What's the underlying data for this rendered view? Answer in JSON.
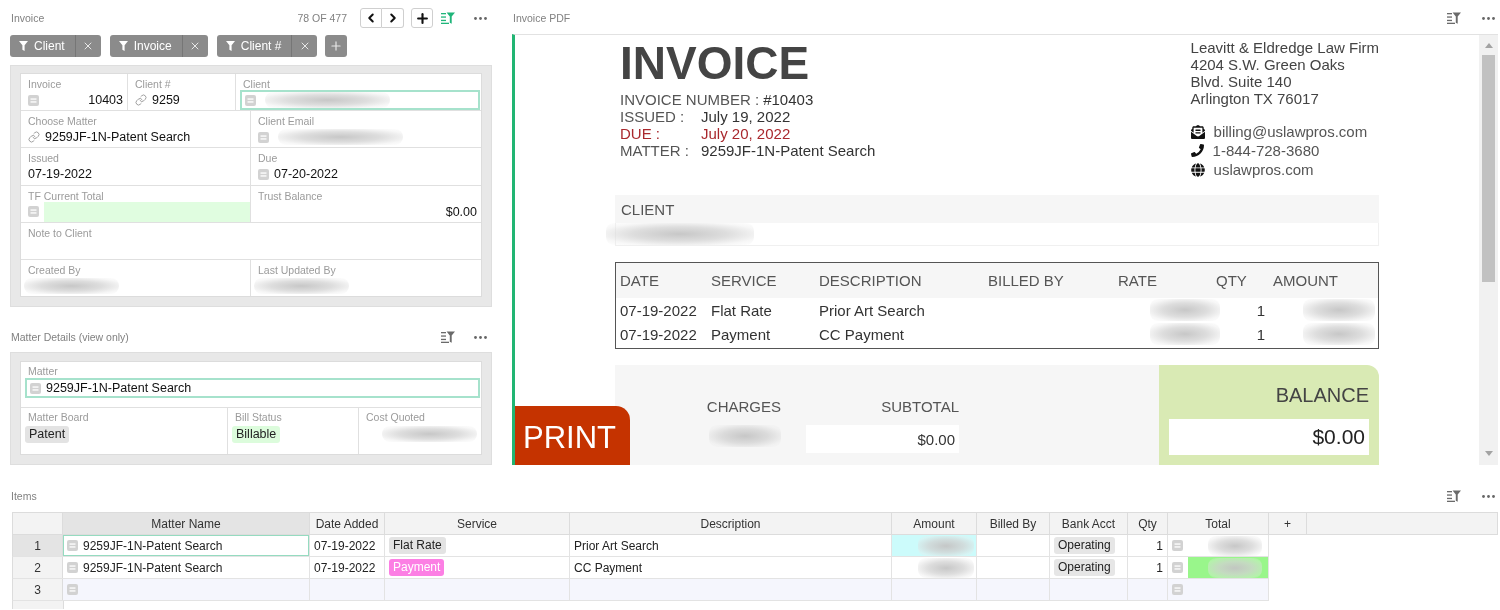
{
  "invoice_panel": {
    "title": "Invoice",
    "filtered": true,
    "position": "78 OF 477",
    "filters": [
      {
        "label": "Client"
      },
      {
        "label": "Invoice"
      },
      {
        "label": "Client #"
      }
    ],
    "rows": [
      [
        {
          "label": "Invoice",
          "kind": "number",
          "value": "10403",
          "focused": false,
          "highlighted": false,
          "redacted": false
        },
        {
          "label": "Client #",
          "kind": "link",
          "value": "9259",
          "focused": false,
          "highlighted": false,
          "redacted": false
        },
        {
          "label": "Client",
          "kind": "lookup",
          "focused": true,
          "highlighted": false,
          "redacted": true
        }
      ],
      [
        {
          "label": "Choose Matter",
          "kind": "link",
          "value": "9259JF-1N-Patent Search",
          "focused": false,
          "highlighted": false,
          "redacted": false
        },
        {
          "label": "Client Email",
          "kind": "lookup",
          "focused": false,
          "highlighted": false,
          "redacted": true
        }
      ],
      [
        {
          "label": "Issued",
          "kind": "text",
          "value": "07-19-2022",
          "focused": false,
          "highlighted": false,
          "redacted": false
        },
        {
          "label": "Due",
          "kind": "lookup",
          "value": "07-20-2022",
          "focused": false,
          "highlighted": false,
          "redacted": false
        }
      ],
      [
        {
          "label": "TF Current Total",
          "kind": "lookup",
          "focused": false,
          "highlighted": true,
          "redacted": false
        },
        {
          "label": "Trust Balance",
          "kind": "currency",
          "value": "$0.00",
          "focused": false,
          "highlighted": false,
          "redacted": false
        }
      ],
      [
        {
          "label": "Note to Client",
          "kind": "text",
          "focused": false,
          "highlighted": false,
          "redacted": false
        }
      ],
      [
        {
          "label": "Created By",
          "kind": "text",
          "focused": false,
          "highlighted": false,
          "redacted": true
        },
        {
          "label": "Last Updated By",
          "kind": "text",
          "focused": false,
          "highlighted": false,
          "redacted": true
        }
      ]
    ]
  },
  "matter_details": {
    "title": "Matter Details (view only)",
    "filtered": false,
    "rows": [
      [
        {
          "label": "Matter",
          "kind": "lookup",
          "value": "9259JF-1N-Patent Search",
          "focused": true,
          "highlighted": false,
          "redacted": false
        }
      ],
      [
        {
          "label": "Matter Board",
          "kind": "tag",
          "value": "Patent",
          "color": "#e3e3e3",
          "focused": false,
          "highlighted": false,
          "redacted": false
        },
        {
          "label": "Bill Status",
          "kind": "tag",
          "value": "Billable",
          "color": "#dcfcdc",
          "focused": false,
          "highlighted": false,
          "redacted": false
        },
        {
          "label": "Cost Quoted",
          "kind": "text",
          "focused": false,
          "highlighted": false,
          "redacted": true
        }
      ]
    ]
  },
  "invoice_pdf": {
    "title": "Invoice PDF",
    "filtered": false,
    "heading": "INVOICE",
    "meta": [
      {
        "label": "INVOICE NUMBER :",
        "value": "#10403",
        "alert": false
      },
      {
        "label": "ISSUED :",
        "value": "July 19, 2022",
        "alert": false
      },
      {
        "label": "DUE :",
        "value": "July 20, 2022",
        "alert": true
      },
      {
        "label": "MATTER :",
        "value": "9259JF-1N-Patent Search",
        "alert": false
      }
    ],
    "firm": {
      "address": [
        "Leavitt & Eldredge Law Firm",
        "4204 S.W. Green Oaks",
        "Blvd. Suite 140",
        "Arlington TX 76017"
      ],
      "contacts": [
        {
          "kind": "email",
          "text": "billing@uslawpros.com"
        },
        {
          "kind": "phone",
          "text": "1-844-728-3680"
        },
        {
          "kind": "web",
          "text": "uslawpros.com"
        }
      ]
    },
    "client": {
      "heading": "CLIENT",
      "redacted": true
    },
    "line_items": {
      "columns": [
        "DATE",
        "SERVICE",
        "DESCRIPTION",
        "BILLED BY",
        "RATE",
        "QTY",
        "AMOUNT"
      ],
      "rows": [
        {
          "date": "07-19-2022",
          "service": "Flat Rate",
          "description": "Prior Art Search",
          "qty": "1",
          "redacted": true
        },
        {
          "date": "07-19-2022",
          "service": "Payment",
          "description": "CC Payment",
          "qty": "1",
          "redacted": true
        }
      ]
    },
    "totals": {
      "charges": {
        "label": "CHARGES",
        "redacted": true
      },
      "subtotal": {
        "label": "SUBTOTAL",
        "value": "$0.00"
      },
      "balance": {
        "label": "BALANCE",
        "value": "$0.00"
      }
    },
    "print_label": "PRINT"
  },
  "items": {
    "title": "Items",
    "filtered": false,
    "columns": [
      {
        "label": "Matter Name",
        "selected": true
      },
      {
        "label": "Date Added",
        "selected": false
      },
      {
        "label": "Service",
        "selected": false
      },
      {
        "label": "Description",
        "selected": false
      },
      {
        "label": "Amount",
        "selected": false
      },
      {
        "label": "Billed By",
        "selected": false
      },
      {
        "label": "Bank Acct",
        "selected": false
      },
      {
        "label": "Qty",
        "selected": false
      },
      {
        "label": "Total",
        "selected": false
      }
    ],
    "add_column": "+",
    "rows": [
      {
        "number": "1",
        "kind": "item",
        "selected": true,
        "matter_name": "9259JF-1N-Patent Search",
        "date_added": "07-19-2022",
        "service": {
          "label": "Flat Rate",
          "color": "#e3e3e3"
        },
        "description": "Prior Art Search",
        "amount": {
          "redacted": true,
          "color": "#ccfbfb"
        },
        "bank_acct": "Operating",
        "qty": "1",
        "total": {
          "redacted": true
        }
      },
      {
        "number": "2",
        "kind": "item",
        "selected": false,
        "matter_name": "9259JF-1N-Patent Search",
        "date_added": "07-19-2022",
        "service": {
          "label": "Payment",
          "color": "#fc7fe4"
        },
        "description": "CC Payment",
        "amount": {
          "redacted": true
        },
        "bank_acct": "Operating",
        "qty": "1",
        "total": {
          "redacted": true,
          "color": "#99f68b"
        }
      },
      {
        "number": "3",
        "kind": "new",
        "selected": false
      }
    ]
  }
}
